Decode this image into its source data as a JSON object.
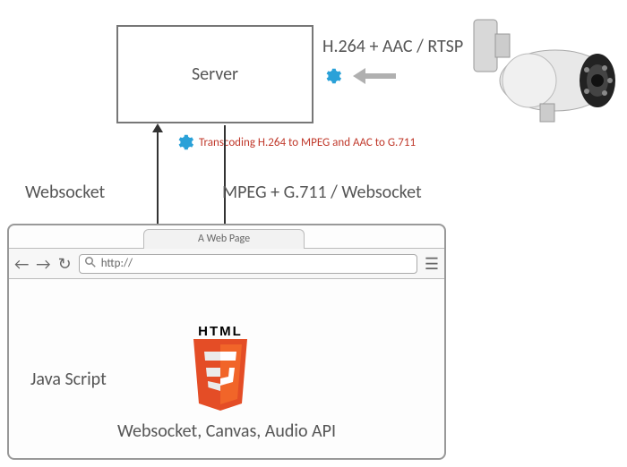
{
  "server": {
    "label": "Server"
  },
  "camera": {
    "protocol": "H.264 + AAC / RTSP"
  },
  "transcoding": {
    "note": "Transcoding  H.264 to MPEG and AAC to G.711"
  },
  "labels": {
    "websocket": "Websocket",
    "mpeg": "MPEG + G.711 / Websocket",
    "javascript": "Java Script",
    "bottom": "Websocket, Canvas,  Audio API"
  },
  "browser": {
    "tab_title": "A Web Page",
    "address": "http://"
  },
  "html5": {
    "text": "HTML"
  }
}
